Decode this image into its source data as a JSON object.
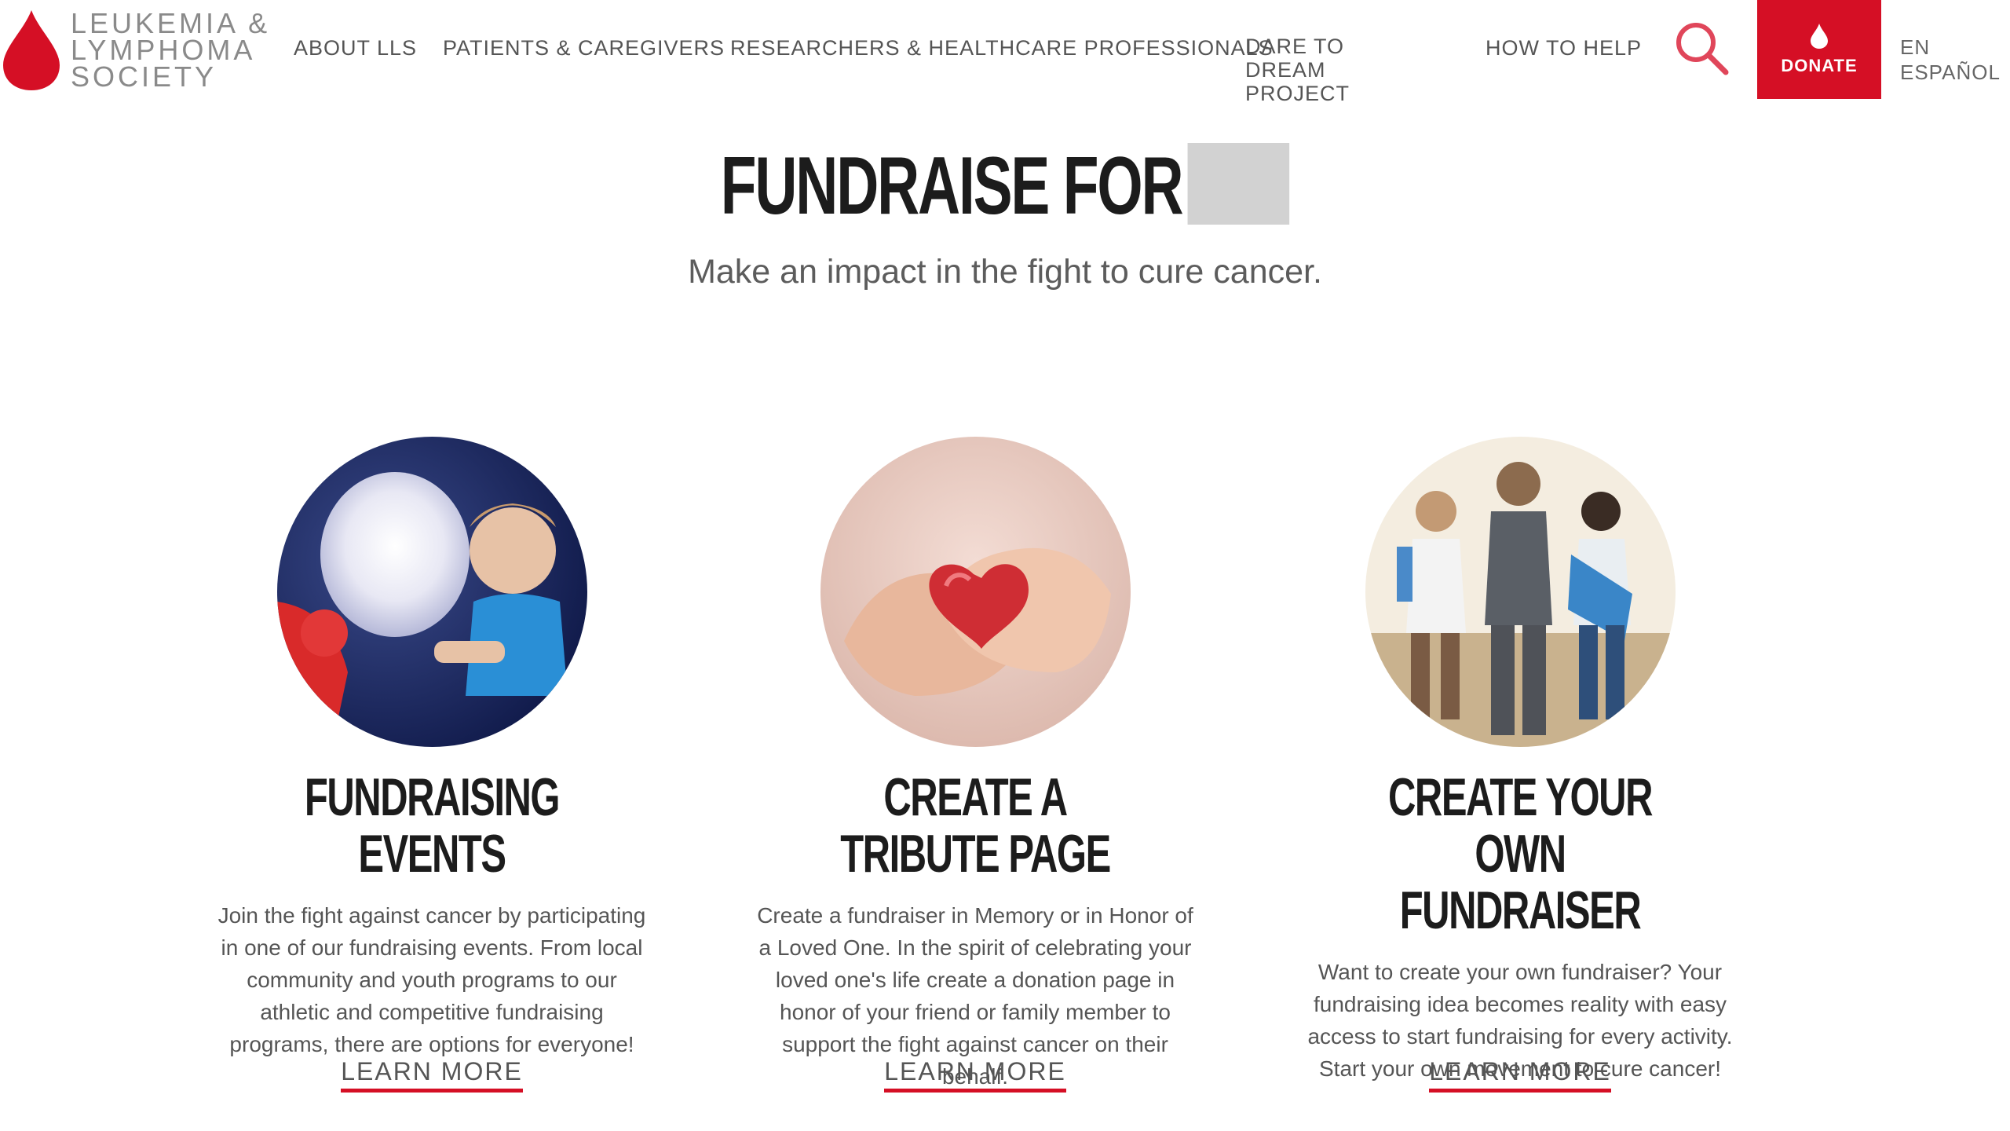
{
  "brand": {
    "name_lines": [
      "LEUKEMIA &",
      "LYMPHOMA",
      "SOCIETY"
    ],
    "accent_color": "#d50f25"
  },
  "nav": {
    "items": [
      {
        "label": "ABOUT LLS"
      },
      {
        "label": "PATIENTS & CAREGIVERS"
      },
      {
        "label": "RESEARCHERS & HEALTHCARE PROFESSIONALS"
      },
      {
        "label": "DARE TO DREAM PROJECT"
      },
      {
        "label": "HOW TO HELP"
      }
    ],
    "search_icon": "search-icon",
    "donate_label": "DONATE",
    "lang_label": "EN ESPAÑOL"
  },
  "hero": {
    "title": "FUNDRAISE FOR",
    "subtitle": "Make an impact in the fight to cure cancer."
  },
  "cards": [
    {
      "title": "FUNDRAISING EVENTS",
      "text": "Join the fight against cancer by participating in one of our fundraising events. From local community and youth programs to our athletic and competitive fundraising programs, there are options for everyone!",
      "link": "LEARN MORE",
      "image": "child-with-lantern-image"
    },
    {
      "title": "CREATE A TRIBUTE PAGE",
      "text": "Create a fundraiser in Memory or in Honor of a Loved One. In the spirit of celebrating your loved one's life create a donation page in honor of your friend or family member to support the fight against cancer on their behalf.",
      "link": "LEARN MORE",
      "image": "hands-holding-heart-image"
    },
    {
      "title": "CREATE YOUR OWN FUNDRAISER",
      "text": "Want to create your own fundraiser? Your fundraising idea becomes reality with easy access to start fundraising for every activity. Start your own movement to cure cancer!",
      "link": "LEARN MORE",
      "image": "hikers-walking-image"
    }
  ]
}
